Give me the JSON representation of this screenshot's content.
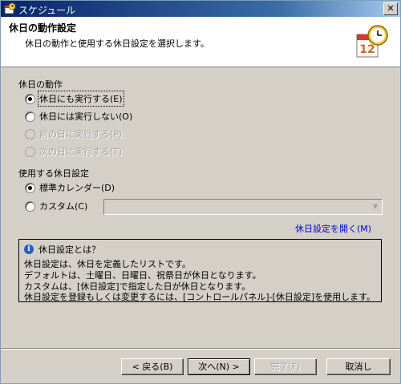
{
  "window": {
    "title": "スケジュール"
  },
  "header": {
    "title": "休日の動作設定",
    "subtitle": "休日の動作と使用する休日設定を選択します。"
  },
  "holiday_action": {
    "label": "休日の動作",
    "options": [
      {
        "label": "休日にも実行する(E)",
        "selected": true,
        "enabled": true
      },
      {
        "label": "休日には実行しない(O)",
        "selected": false,
        "enabled": true
      },
      {
        "label": "前の日に実行する(P)",
        "selected": false,
        "enabled": false
      },
      {
        "label": "次の日に実行する(T)",
        "selected": false,
        "enabled": false
      }
    ]
  },
  "holiday_setting": {
    "label": "使用する休日設定",
    "options": [
      {
        "label": "標準カレンダー(D)",
        "selected": true,
        "enabled": true
      },
      {
        "label": "カスタム(C)",
        "selected": false,
        "enabled": true
      }
    ],
    "custom_value": "",
    "open_link": "休日設定を開く(M)"
  },
  "info": {
    "title": "休日設定とは？",
    "lines": [
      "休日設定は、休日を定義したリストです。",
      "デフォルトは、土曜日、日曜日、祝祭日が休日となります。",
      "カスタムは、[休日設定]で指定した日が休日となります。",
      "休日設定を登録もしくは変更するには、[コントロールパネル]-[休日設定]を使用します。"
    ]
  },
  "buttons": {
    "back": "< 戻る(B)",
    "next": "次へ(N) >",
    "finish": "完了(F)",
    "cancel": "取消し"
  },
  "icons": {
    "title": "schedule-icon",
    "header": "calendar-clock-icon",
    "info": "info-icon",
    "calendar_day": "12"
  }
}
